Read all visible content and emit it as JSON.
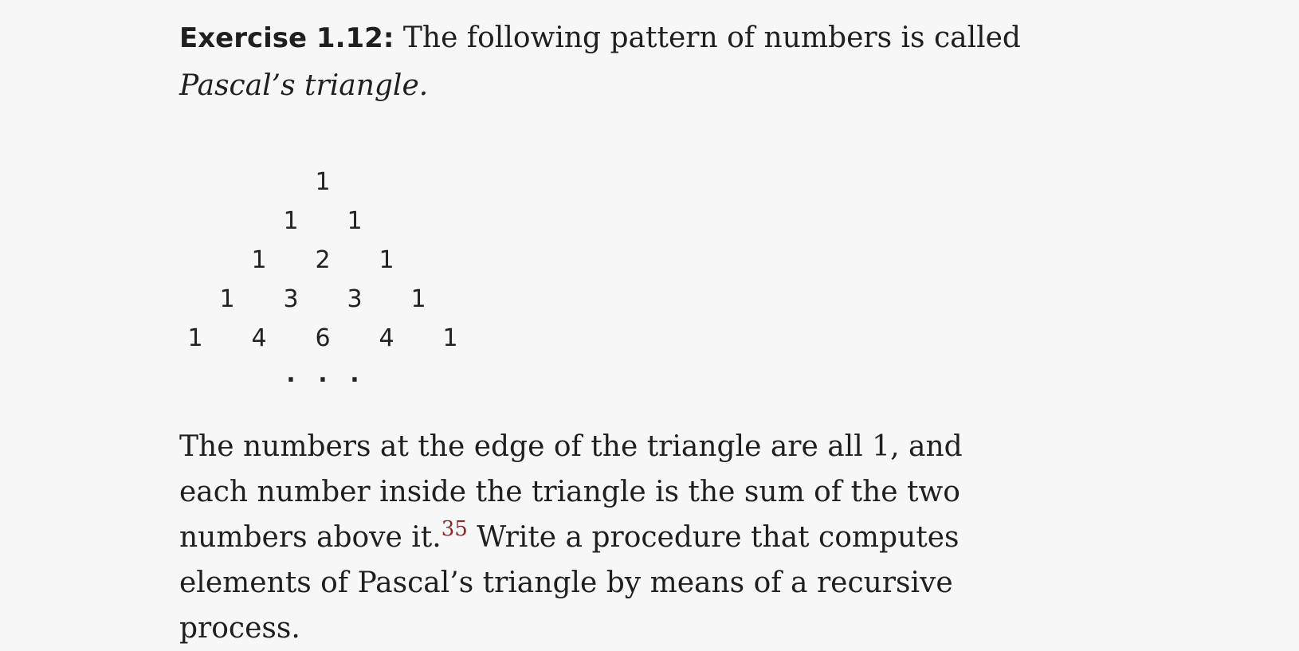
{
  "exercise": {
    "label": "Exercise 1.12:",
    "intro": " The following pattern of numbers is called",
    "term": "Pascal’s triangle."
  },
  "triangle": {
    "rows": [
      [
        "1"
      ],
      [
        "1",
        "1"
      ],
      [
        "1",
        "2",
        "1"
      ],
      [
        "1",
        "3",
        "3",
        "1"
      ],
      [
        "1",
        "4",
        "6",
        "4",
        "1"
      ]
    ],
    "ellipsis": [
      ".",
      ".",
      "."
    ]
  },
  "paragraph": {
    "before_footnote": "The numbers at the edge of the triangle are all 1, and each number inside the triangle is the sum of the two numbers above it.",
    "footnote_ref": "35",
    "after_footnote": " Write a procedure that computes elements of Pascal’s triangle by means of a recursive process."
  }
}
